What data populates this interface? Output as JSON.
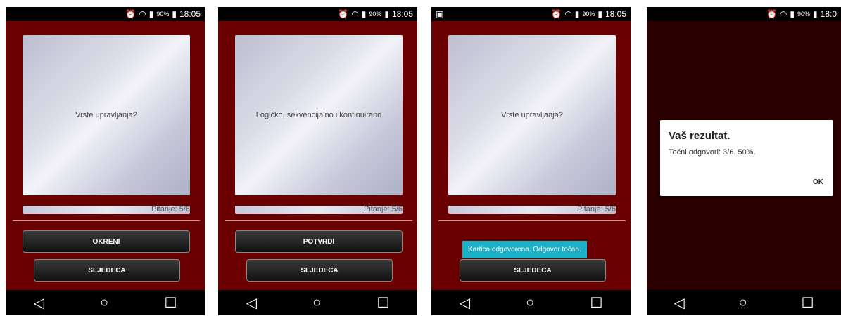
{
  "status": {
    "battery": "90%",
    "time": "18:05",
    "time4": "18:0"
  },
  "icons": {
    "alarm": "alarm-icon",
    "wifi": "wifi-icon",
    "signal": "signal-icon",
    "battery": "battery-icon",
    "image": "image-notification-icon"
  },
  "screens": [
    {
      "card_text": "Vrste upravljanja?",
      "progress_label": "Pitanje: 5/6",
      "button1": "OKRENI",
      "button2": "SLJEDECA"
    },
    {
      "card_text": "Logičko, sekvencijalno i kontinuirano",
      "progress_label": "Pitanje: 5/6",
      "button1": "POTVRDI",
      "button2": "SLJEDECA"
    },
    {
      "card_text": "Vrste upravljanja?",
      "progress_label": "Pitanje: 5/6",
      "toast": "Kartica odgovorena. Odgovor točan.",
      "button2": "SLJEDECA"
    }
  ],
  "dialog": {
    "title": "Vaš rezultat.",
    "message": "Točni odgovori: 3/6. 50%.",
    "ok": "OK"
  },
  "nav": {
    "back": "◁",
    "home": "○",
    "recent": "☐"
  }
}
